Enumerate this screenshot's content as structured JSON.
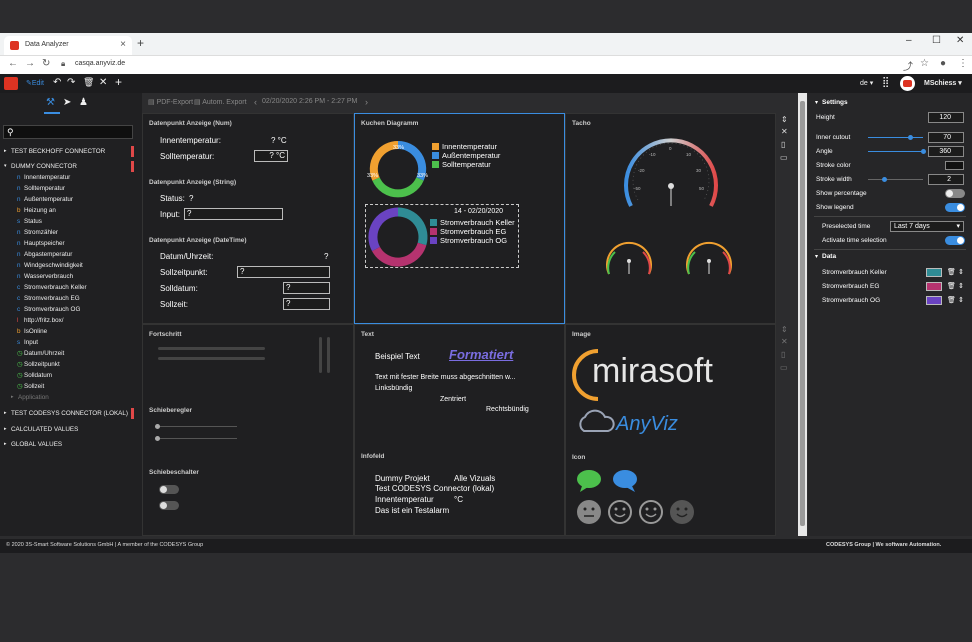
{
  "browser": {
    "tab_title": "Data Analyzer",
    "url": "casqa.anyviz.de"
  },
  "toolbar": {
    "edit_label": "Edit",
    "language": "de ▾",
    "user": "MSchiess ▾"
  },
  "sidebar": {
    "groups": [
      {
        "label": "TEST BECKHOFF CONNECTOR"
      },
      {
        "label": "DUMMY CONNECTOR"
      },
      {
        "label": "TEST CODESYS CONNECTOR (LOKAL)"
      },
      {
        "label": "CALCULATED VALUES"
      },
      {
        "label": "GLOBAL VALUES"
      }
    ],
    "items": [
      {
        "prefix": "n",
        "label": "Innentemperatur"
      },
      {
        "prefix": "n",
        "label": "Solltemperatur"
      },
      {
        "prefix": "n",
        "label": "Außentemperatur"
      },
      {
        "prefix": "b",
        "label": "Heizung an"
      },
      {
        "prefix": "s",
        "label": "Status"
      },
      {
        "prefix": "n",
        "label": "Stromzähler"
      },
      {
        "prefix": "n",
        "label": "Hauptspeicher"
      },
      {
        "prefix": "n",
        "label": "Abgastemperatur"
      },
      {
        "prefix": "n",
        "label": "Windgeschwindigkeit"
      },
      {
        "prefix": "n",
        "label": "Wasserverbrauch"
      },
      {
        "prefix": "c",
        "label": "Stromverbrauch Keller"
      },
      {
        "prefix": "c",
        "label": "Stromverbrauch EG"
      },
      {
        "prefix": "c",
        "label": "Stromverbrauch OG"
      },
      {
        "prefix": "l",
        "label": "http://fritz.box/"
      },
      {
        "prefix": "b",
        "label": "IsOnline"
      },
      {
        "prefix": "s",
        "label": "Input"
      },
      {
        "prefix": "◷",
        "label": "Datum/Uhrzeit"
      },
      {
        "prefix": "◷",
        "label": "Sollzeitpunkt"
      },
      {
        "prefix": "◷",
        "label": "Solldatum"
      },
      {
        "prefix": "◷",
        "label": "Sollzeit"
      }
    ],
    "application_label": "Application"
  },
  "center_bar": {
    "pdf": "PDF-Export",
    "auto": "Autom. Export",
    "range": "02/20/2020 2:26 PM - 2:27 PM"
  },
  "panels": {
    "num": {
      "title": "Datenpunkt Anzeige (Num)",
      "r1_label": "Innentemperatur:",
      "r1_value": "? °C",
      "r2_label": "Solltemperatur:",
      "r2_value": "? °C"
    },
    "string": {
      "title": "Datenpunkt Anzeige (String)",
      "r1_label": "Status:",
      "r1_value": "?",
      "r2_label": "Input:",
      "r2_value": "?"
    },
    "datetime": {
      "title": "Datenpunkt Anzeige (DateTime)",
      "r1_label": "Datum/Uhrzeit:",
      "r1_value": "?",
      "r2_label": "Sollzeitpunkt:",
      "r2_value": "?",
      "r3_label": "Solldatum:",
      "r3_value": "?",
      "r4_label": "Sollzeit:",
      "r4_value": "?"
    },
    "pie": {
      "title": "Kuchen Diagramm",
      "top_legend": [
        "Innentemperatur",
        "Außentemperatur",
        "Solltemperatur"
      ],
      "top_pcts": [
        "33%",
        "33%",
        "33%"
      ],
      "date": "14 - 02/20/2020",
      "bottom_legend": [
        "Stromverbrauch Keller",
        "Stromverbrauch EG",
        "Stromverbrauch OG"
      ]
    },
    "tacho": {
      "title": "Tacho",
      "ticks": [
        "-20",
        "-10",
        "0",
        "10",
        "20",
        "30",
        "40",
        "-50",
        "50"
      ]
    },
    "fortschritt": {
      "title": "Fortschritt"
    },
    "schieberegler": {
      "title": "Schieberegler"
    },
    "schiebeschalter": {
      "title": "Schiebeschalter"
    },
    "text": {
      "title": "Text",
      "t1": "Beispiel Text",
      "t2": "Formatiert",
      "t3": "Text mit fester Breite muss abgeschnitten w...",
      "t4": "Linksbündig",
      "t5": "Zentriert",
      "t6": "Rechtsbündig"
    },
    "image": {
      "title": "Image",
      "logo1": "mirasoft",
      "logo2": "AnyViz"
    },
    "infofeld": {
      "title": "Infofeld",
      "l1a": "Dummy Projekt",
      "l1b": "Alle Vizuals",
      "l2": "Test CODESYS Connector (lokal)",
      "l3a": "Innentemperatur",
      "l3b": "°C",
      "l4": "Das ist ein Testalarm"
    },
    "icon": {
      "title": "Icon"
    }
  },
  "settings": {
    "title": "Settings",
    "height_label": "Height",
    "height": "120",
    "inner_label": "Inner cutout",
    "inner": "70",
    "angle_label": "Angle",
    "angle": "360",
    "stroke_color_label": "Stroke color",
    "stroke_width_label": "Stroke width",
    "stroke_width": "2",
    "show_pct_label": "Show percentage",
    "show_legend_label": "Show legend",
    "pre_time_label": "Preselected time",
    "pre_time": "Last 7 days",
    "activate_label": "Activate time selection",
    "data_title": "Data",
    "data_rows": [
      {
        "label": "Stromverbrauch Keller",
        "color": "#2f8c95"
      },
      {
        "label": "Stromverbrauch EG",
        "color": "#b5336f"
      },
      {
        "label": "Stromverbrauch OG",
        "color": "#6a43c2"
      }
    ]
  },
  "footer": {
    "left": "© 2020 3S-Smart Software Solutions GmbH | A member of the CODESYS Group",
    "right": "CODESYS Group | We software Automation."
  },
  "colors": {
    "accent": "#2f8fe0",
    "orange": "#f0a030",
    "blue": "#3a8de0",
    "green": "#4cc04c",
    "teal": "#2f8c95",
    "magenta": "#b5336f",
    "purple": "#6a43c2",
    "alert": "#e04848"
  }
}
